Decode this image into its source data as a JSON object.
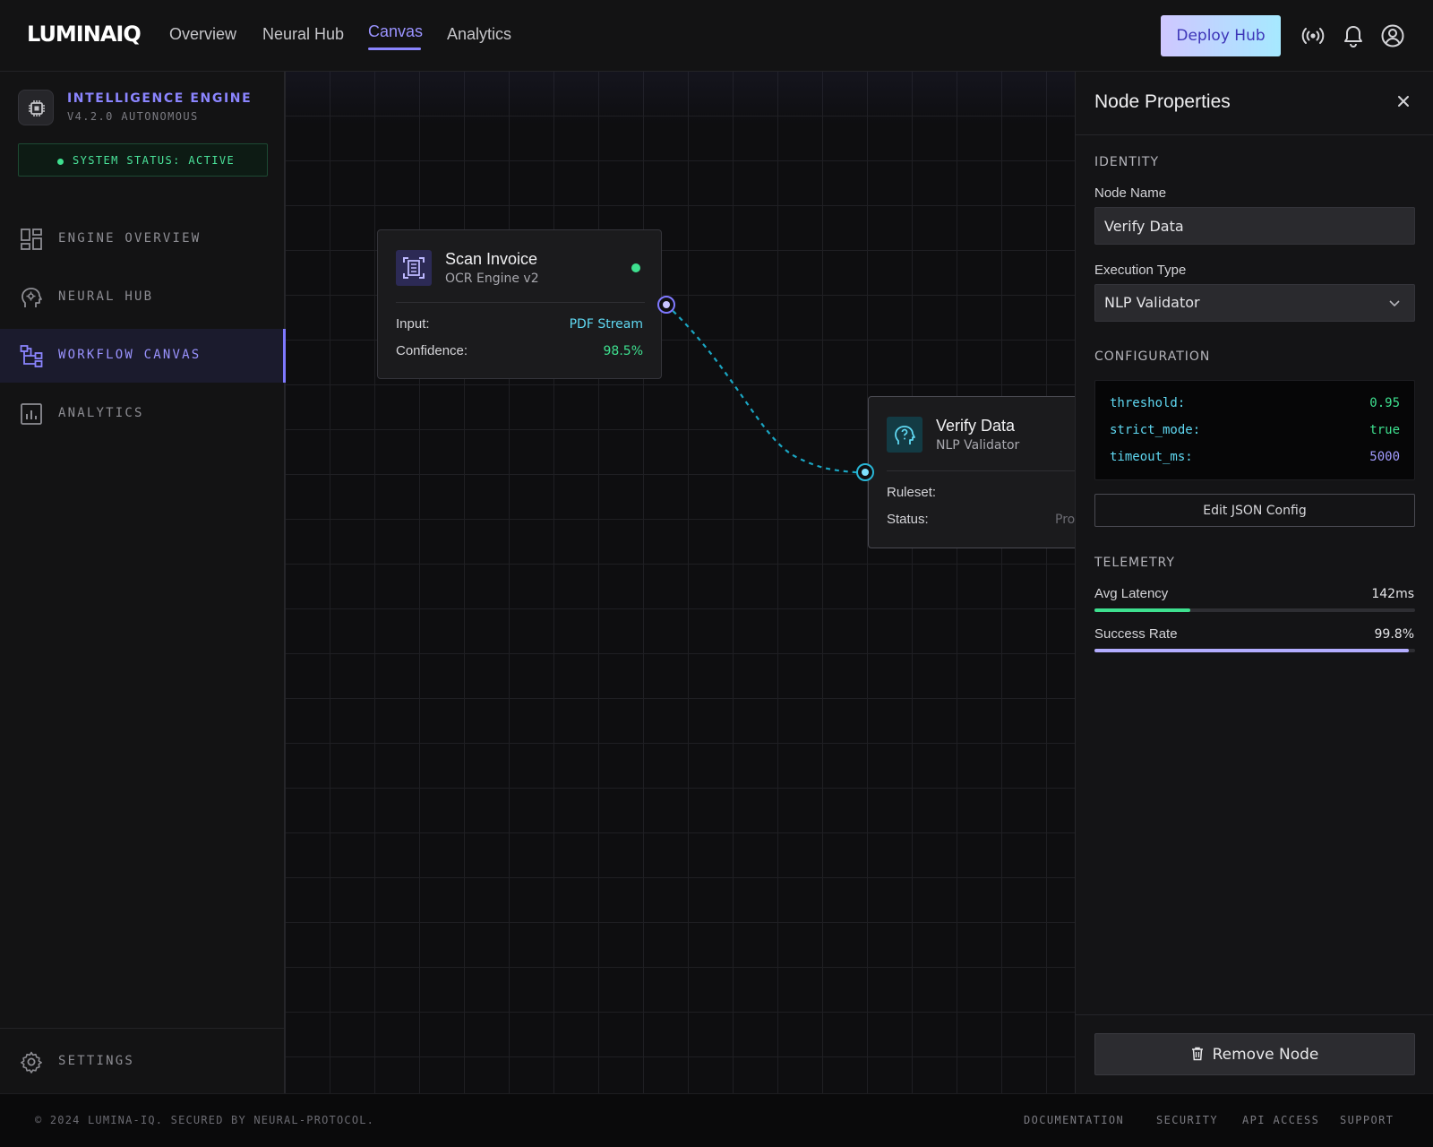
{
  "header": {
    "logo": "LUMINAIQ",
    "nav": [
      {
        "label": "Overview",
        "active": false
      },
      {
        "label": "Neural Hub",
        "active": false
      },
      {
        "label": "Canvas",
        "active": true
      },
      {
        "label": "Analytics",
        "active": false
      }
    ],
    "deploy_label": "Deploy Hub",
    "icons": [
      "broadcast-icon",
      "bell-icon",
      "user-icon"
    ]
  },
  "sidebar": {
    "engine_title": "INTELLIGENCE ENGINE",
    "engine_version": "V4.2.0 AUTONOMOUS",
    "status": "SYSTEM STATUS: ACTIVE",
    "items": [
      {
        "label": "ENGINE OVERVIEW",
        "icon": "grid-icon",
        "active": false
      },
      {
        "label": "NEURAL HUB",
        "icon": "brain-icon",
        "active": false
      },
      {
        "label": "WORKFLOW CANVAS",
        "icon": "workflow-icon",
        "active": true
      },
      {
        "label": "ANALYTICS",
        "icon": "bar-chart-icon",
        "active": false
      }
    ],
    "settings_label": "SETTINGS"
  },
  "canvas": {
    "nodes": [
      {
        "title": "Scan Invoice",
        "subtitle": "OCR Engine v2",
        "icon": "scan-document-icon",
        "status_color": "#3ee08f",
        "fields": [
          {
            "key": "Input:",
            "value": "PDF Stream",
            "color": "#5fd8f2"
          },
          {
            "key": "Confidence:",
            "value": "98.5%",
            "color": "#3ee08f"
          }
        ]
      },
      {
        "title": "Verify Data",
        "subtitle": "NLP Validator",
        "icon": "head-question-icon",
        "fields": [
          {
            "key": "Ruleset:",
            "value": ""
          },
          {
            "key": "Status:",
            "value": "Pro",
            "color": "#6b6b72"
          }
        ]
      }
    ]
  },
  "panel": {
    "title": "Node Properties",
    "identity_label": "IDENTITY",
    "node_name_label": "Node Name",
    "node_name_value": "Verify Data",
    "exec_type_label": "Execution Type",
    "exec_type_value": "NLP Validator",
    "configuration_label": "CONFIGURATION",
    "config": [
      {
        "key": "threshold:",
        "value": "0.95"
      },
      {
        "key": "strict_mode:",
        "value": "true"
      },
      {
        "key": "timeout_ms:",
        "value": "5000"
      }
    ],
    "edit_json_label": "Edit JSON Config",
    "telemetry_label": "TELEMETRY",
    "telemetry": [
      {
        "label": "Avg Latency",
        "value": "142ms",
        "fill_fraction": 0.3,
        "color": "#3ee08f"
      },
      {
        "label": "Success Rate",
        "value": "99.8%",
        "fill_fraction": 0.98,
        "color": "#b3adff"
      }
    ],
    "remove_label": "Remove Node"
  },
  "footer": {
    "copyright": "© 2024 LUMINA-IQ. SECURED BY NEURAL-PROTOCOL.",
    "links": [
      "DOCUMENTATION",
      "SECURITY",
      "API ACCESS",
      "SUPPORT"
    ]
  }
}
